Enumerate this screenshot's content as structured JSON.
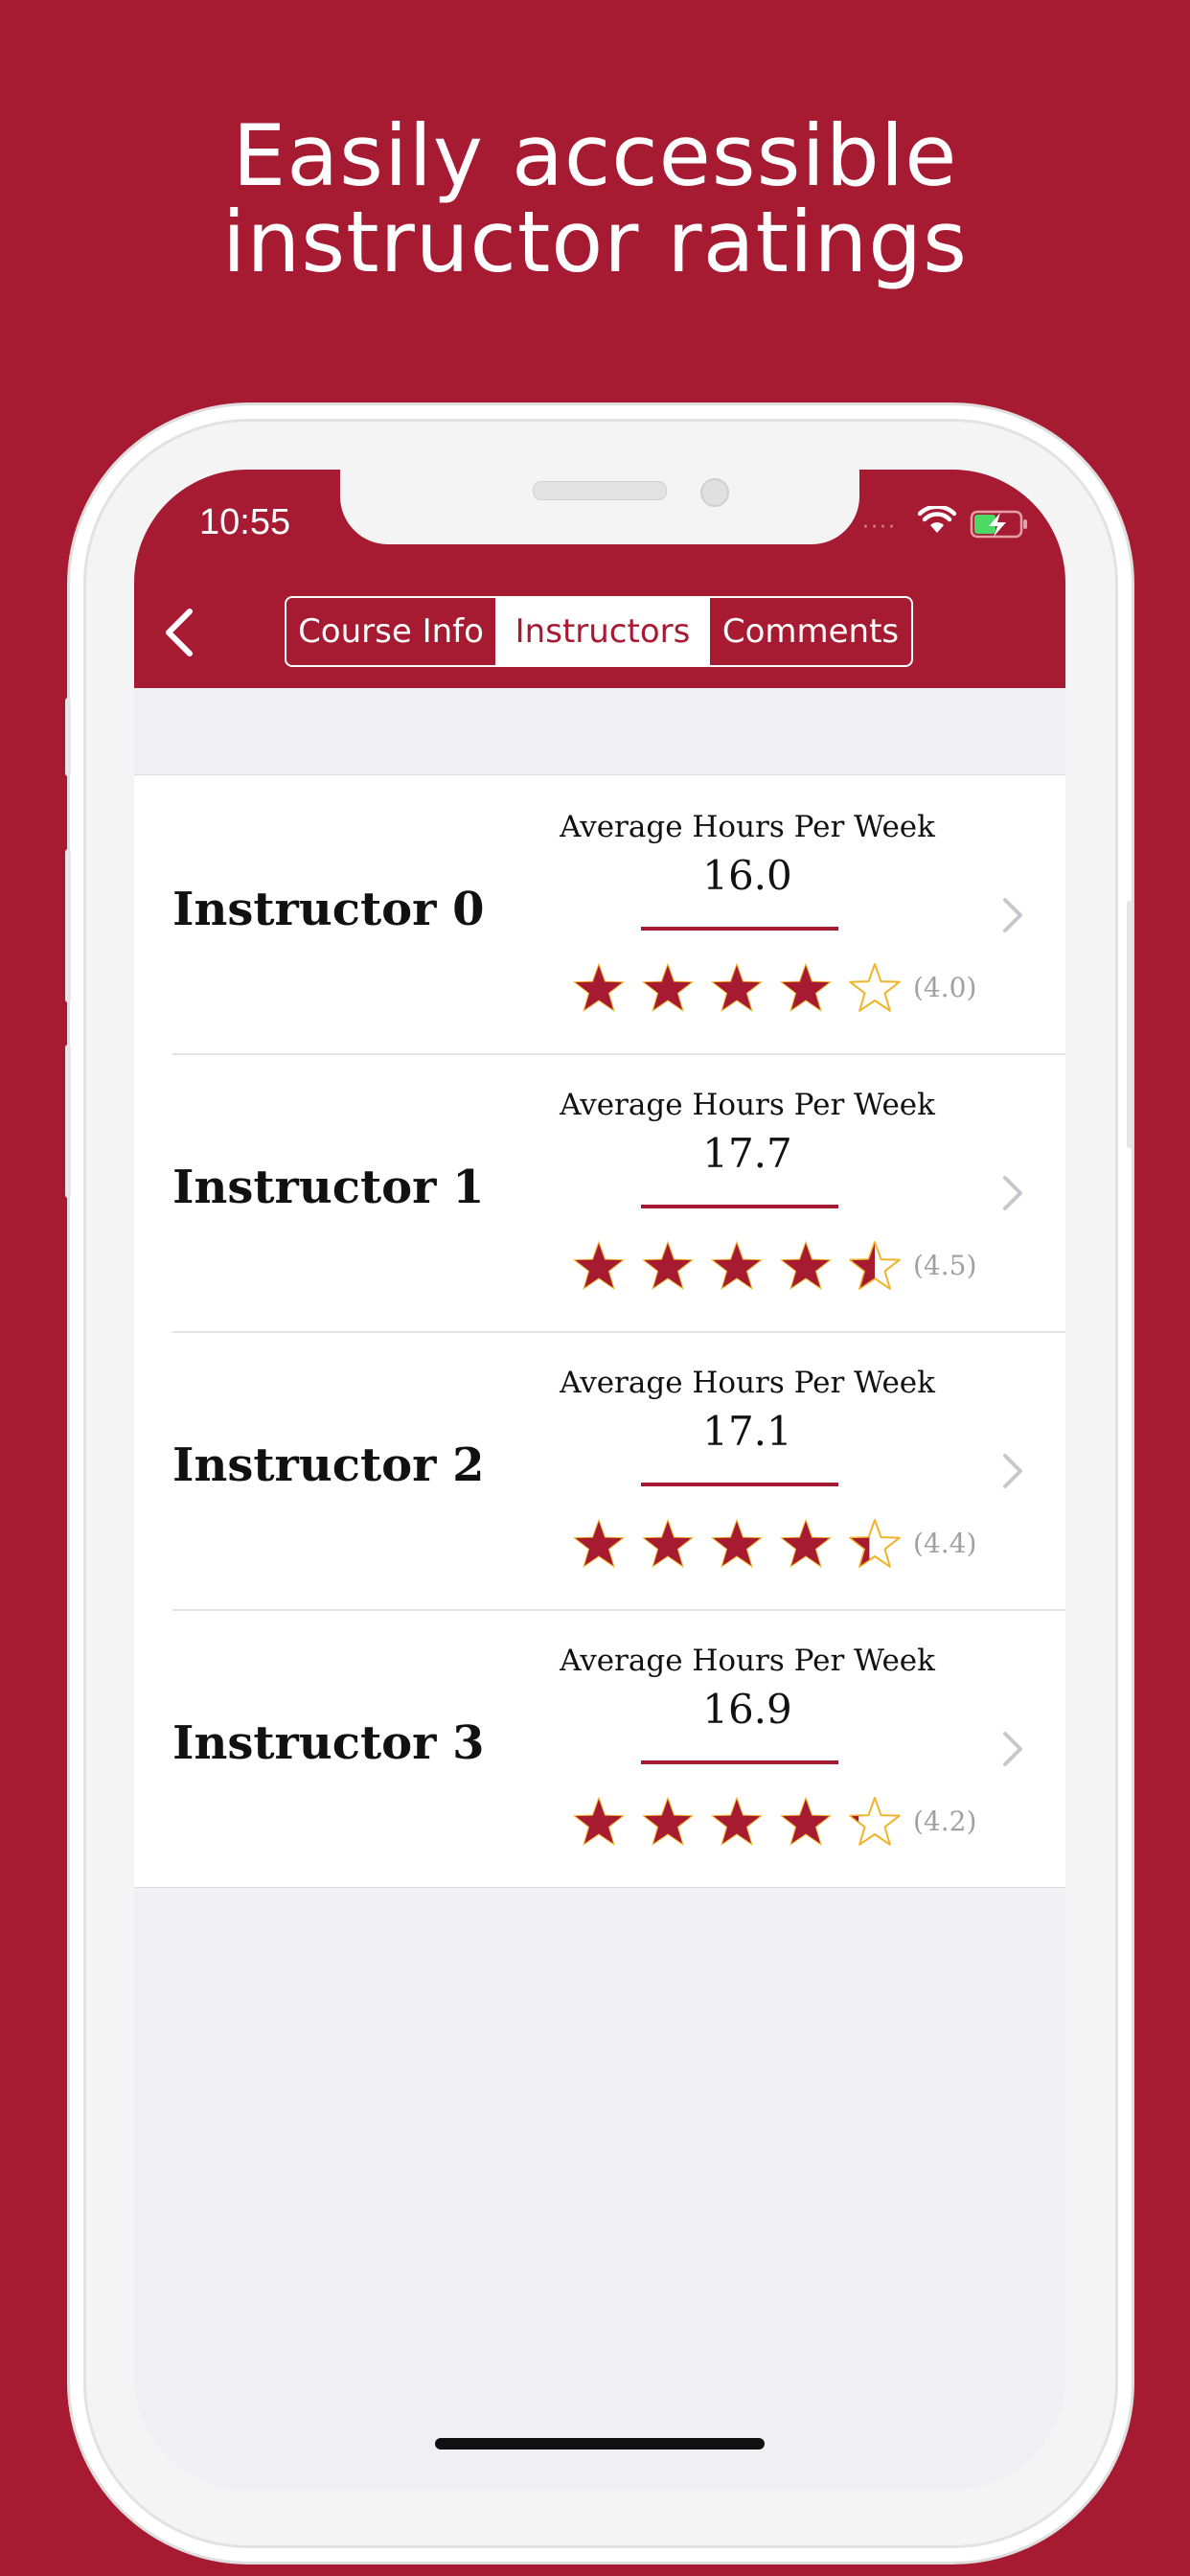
{
  "headline": {
    "line1": "Easily accessible",
    "line2": "instructor ratings"
  },
  "status_bar": {
    "time": "10:55",
    "signal": "····"
  },
  "nav": {
    "back_icon": "chevron-left-icon",
    "segments": [
      "Course Info",
      "Instructors",
      "Comments"
    ],
    "selected_segment": "Instructors"
  },
  "instructors": [
    {
      "name": "Instructor 0",
      "hours_label": "Average Hours Per Week",
      "hours": "16.0",
      "stars": 4.0,
      "rating": "(4.0)"
    },
    {
      "name": "Instructor 1",
      "hours_label": "Average Hours Per Week",
      "hours": "17.7",
      "stars": 4.5,
      "rating": "(4.5)"
    },
    {
      "name": "Instructor 2",
      "hours_label": "Average Hours Per Week",
      "hours": "17.1",
      "stars": 4.4,
      "rating": "(4.4)"
    },
    {
      "name": "Instructor 3",
      "hours_label": "Average Hours Per Week",
      "hours": "16.9",
      "stars": 4.2,
      "rating": "(4.2)"
    }
  ],
  "colors": {
    "brand": "#a61a32",
    "star_outline": "#f0b429",
    "background": "#efeff4"
  }
}
